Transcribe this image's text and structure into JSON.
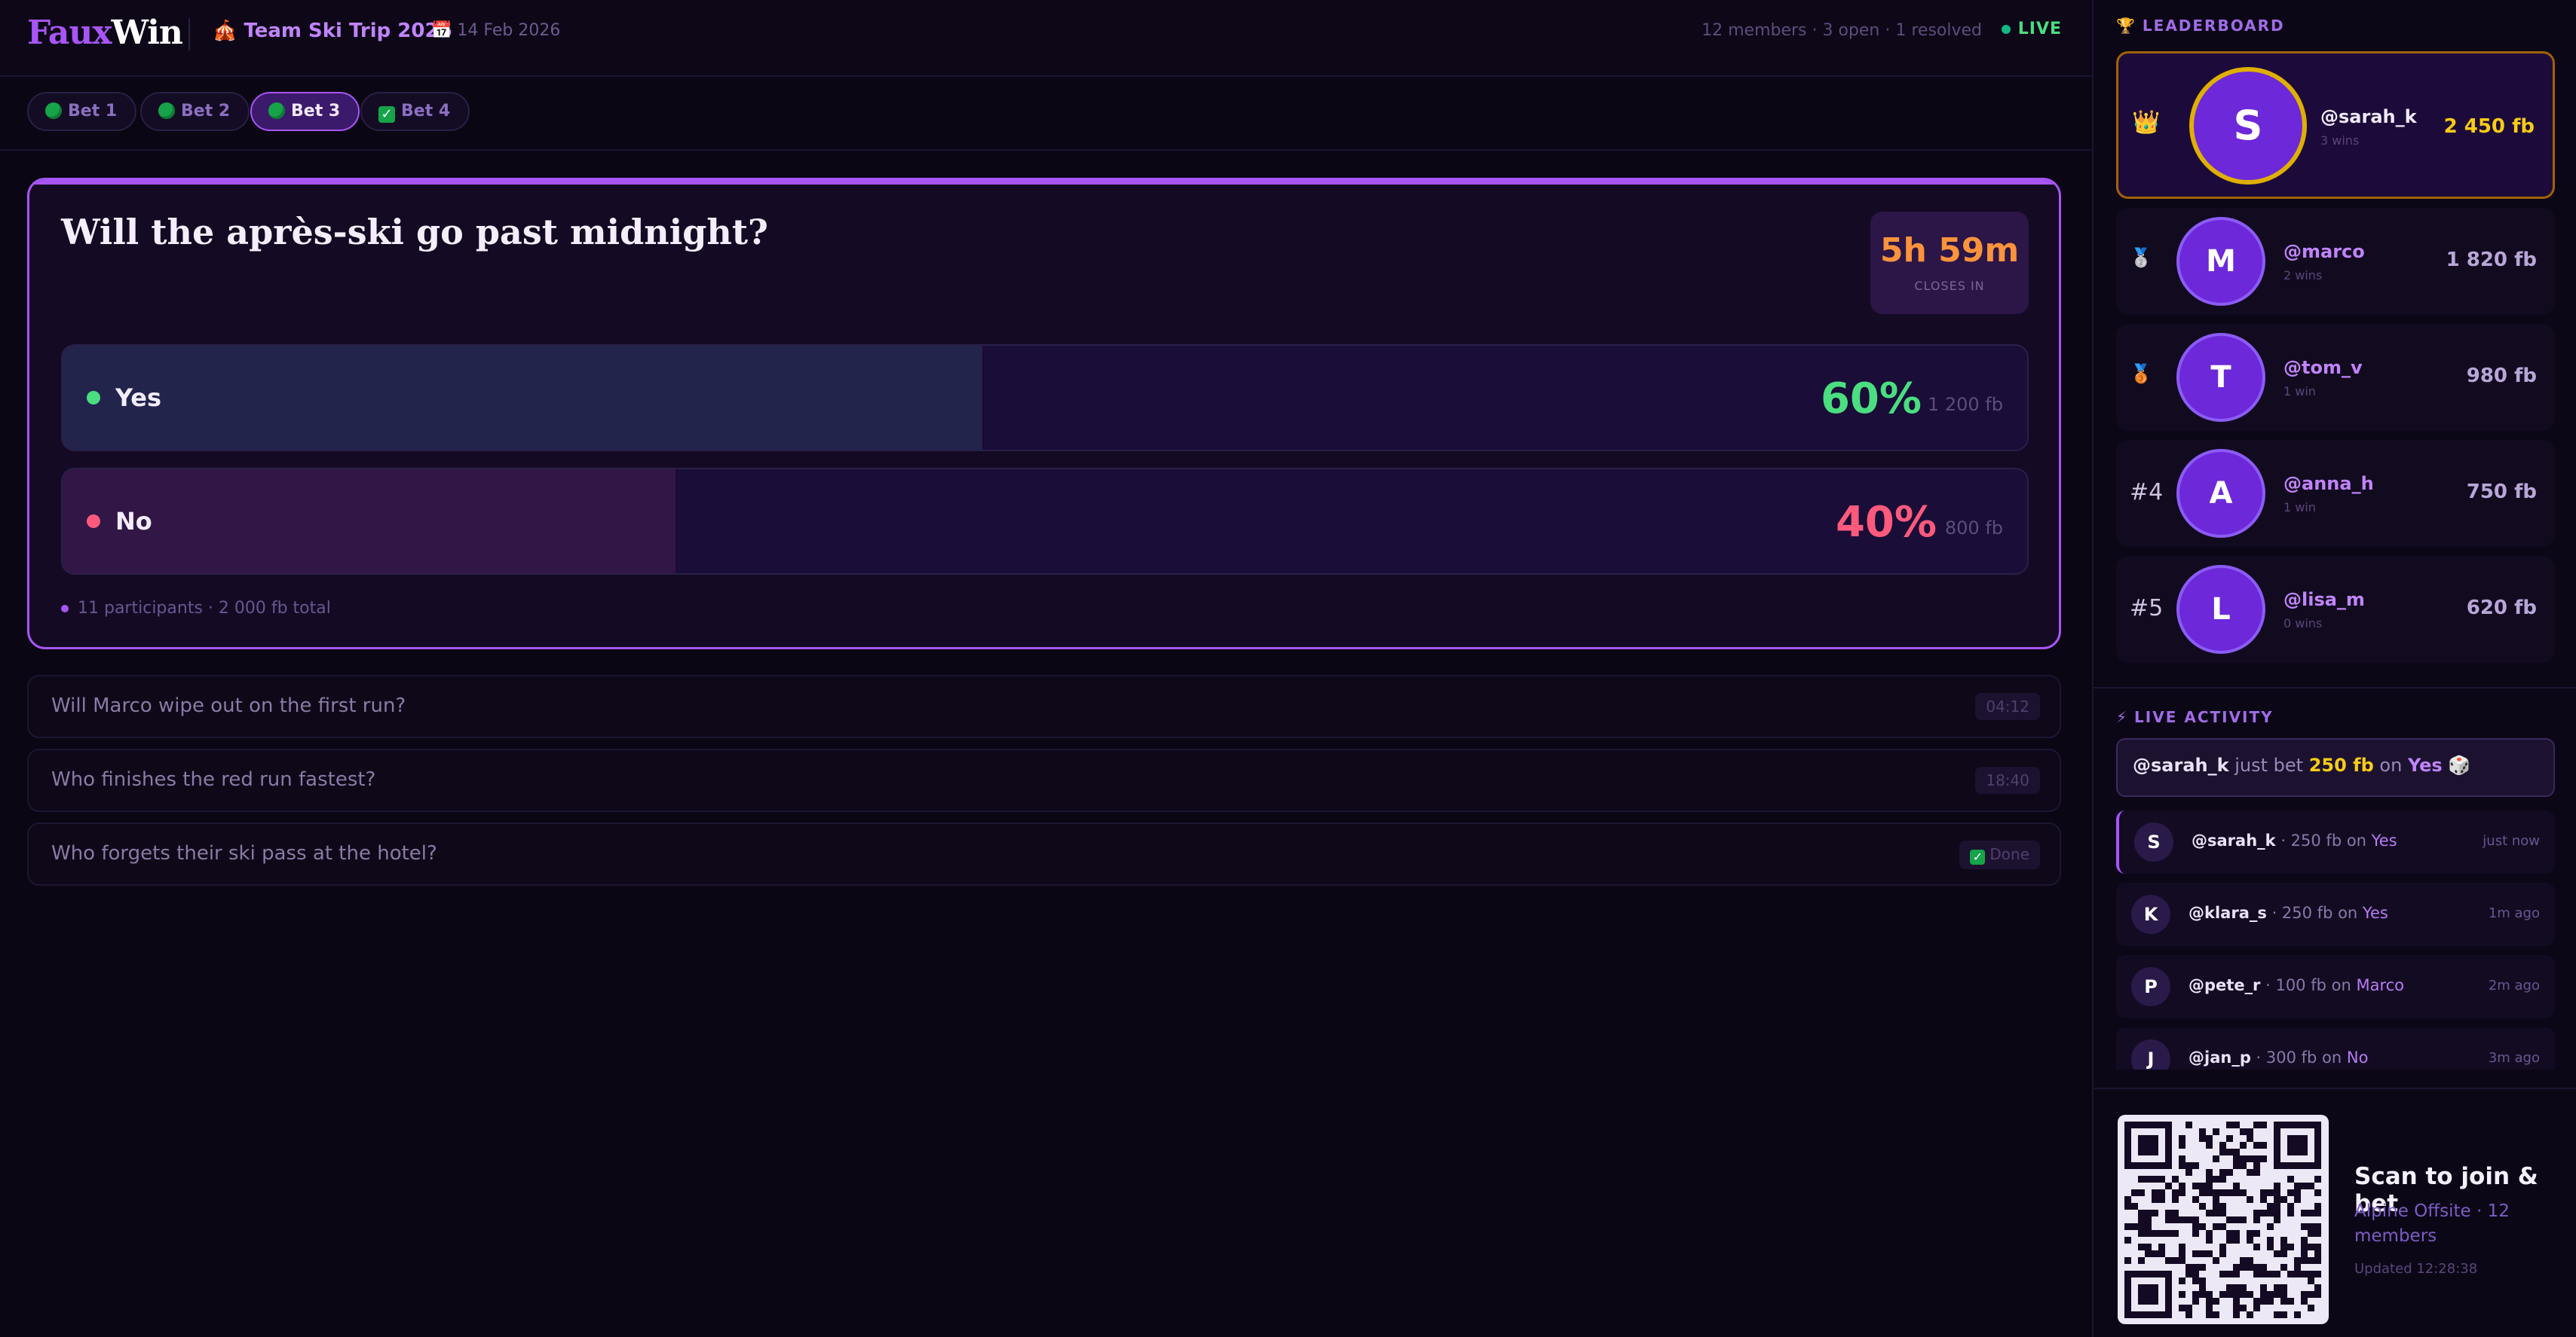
{
  "header": {
    "logo_part1": "Faux",
    "logo_part2": "Win",
    "trip_icon": "🎪",
    "trip_name": "Team Ski Trip 2026",
    "date_icon": "📅",
    "date": "14 Feb 2026",
    "stats": "12 members · 3 open · 1 resolved",
    "live_label": "LIVE"
  },
  "tabs": [
    {
      "label": "Bet 1",
      "status": "open"
    },
    {
      "label": "Bet 2",
      "status": "open"
    },
    {
      "label": "Bet 3",
      "status": "open",
      "active": true
    },
    {
      "label": "Bet 4",
      "status": "resolved"
    }
  ],
  "current_bet": {
    "question": "Will the après-ski go past midnight?",
    "timer": "5h 59m",
    "timer_label": "CLOSES IN",
    "options": [
      {
        "label": "Yes",
        "percent": 60,
        "percent_label": "60%",
        "amount": "1 200 fb",
        "color": "#4ade80"
      },
      {
        "label": "No",
        "percent": 40,
        "percent_label": "40%",
        "amount": "800 fb",
        "color": "#fb5a7c"
      }
    ],
    "footer": "11 participants · 2 000 fb total"
  },
  "other_bets": [
    {
      "question": "Will Marco wipe out on the first run?",
      "tag": "04:12"
    },
    {
      "question": "Who finishes the red run fastest?",
      "tag": "18:40"
    },
    {
      "question": "Who forgets their ski pass at the hotel?",
      "tag": "Done"
    }
  ],
  "leaderboard": {
    "title": "LEADERBOARD",
    "title_icon": "trophy-icon",
    "entries": [
      {
        "rank": "👑",
        "initial": "S",
        "name": "@sarah_k",
        "wins": "3 wins",
        "fb": "2 450 fb"
      },
      {
        "rank": "🥈",
        "initial": "M",
        "name": "@marco",
        "wins": "2 wins",
        "fb": "1 820 fb"
      },
      {
        "rank": "🥉",
        "initial": "T",
        "name": "@tom_v",
        "wins": "1 win",
        "fb": "980 fb"
      },
      {
        "rank": "#4",
        "initial": "A",
        "name": "@anna_h",
        "wins": "1 win",
        "fb": "750 fb"
      },
      {
        "rank": "#5",
        "initial": "L",
        "name": "@lisa_m",
        "wins": "0 wins",
        "fb": "620 fb"
      }
    ]
  },
  "live_activity": {
    "title": "LIVE ACTIVITY",
    "title_icon": "lightning-icon",
    "ticker": {
      "user": "@sarah_k",
      "mid": "just bet",
      "amount": "250 fb",
      "on": "on",
      "choice": "Yes",
      "icon": "🎲"
    },
    "items": [
      {
        "initial": "S",
        "user": "@sarah_k",
        "amount": "· 250 fb on",
        "choice": "Yes",
        "time": "just now"
      },
      {
        "initial": "K",
        "user": "@klara_s",
        "amount": "· 250 fb on",
        "choice": "Yes",
        "time": "1m ago"
      },
      {
        "initial": "P",
        "user": "@pete_r",
        "amount": "· 100 fb on",
        "choice": "Marco",
        "time": "2m ago"
      },
      {
        "initial": "J",
        "user": "@jan_p",
        "amount": "· 300 fb on",
        "choice": "No",
        "time": "3m ago"
      }
    ]
  },
  "join": {
    "title": "Scan to join & bet",
    "subtitle": "Alpine Offsite · 12 members",
    "updated": "Updated 12:28:38"
  },
  "colors": {
    "accent": "#a855f7",
    "yes": "#4ade80",
    "no": "#fb5a7c",
    "gold": "#facc15",
    "timer": "#fb923c"
  }
}
